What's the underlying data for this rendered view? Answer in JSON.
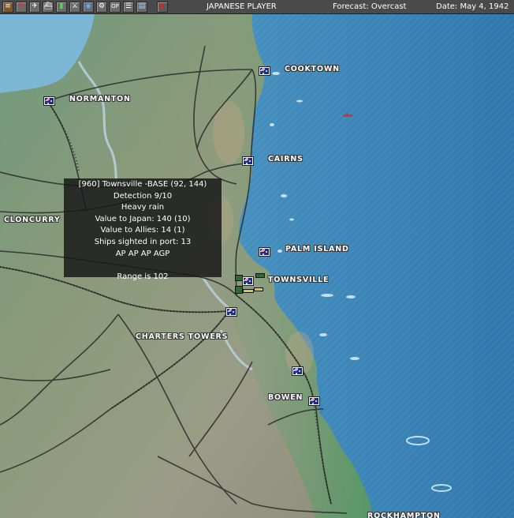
{
  "toolbar": {
    "buttons": [
      "menu-icon",
      "flag-icon",
      "aircraft-icon",
      "ship-icon",
      "bar-chart-icon",
      "units-icon",
      "globe-icon",
      "settings-icon",
      "ops-icon",
      "list-icon",
      "report-icon",
      "end-turn-icon"
    ],
    "ops_label": "OP",
    "player": "JAPANESE PLAYER",
    "forecast": "Forecast: Overcast",
    "date": "Date: May 4, 1942"
  },
  "map": {
    "places": {
      "cooktown": "COOKTOWN",
      "normanton": "NORMANTON",
      "cairns": "CAIRNS",
      "cloncurry": "CLONCURRY",
      "palm_island": "PALM ISLAND",
      "townsville": "TOWNSVILLE",
      "charters_towers": "CHARTERS TOWERS",
      "bowen": "BOWEN",
      "rockhampton": "ROCKHAMPTON"
    }
  },
  "tooltip": {
    "line1": "[960] Townsville -BASE (92, 144)",
    "line2": "Detection 9/10",
    "line3": "Heavy rain",
    "line4": "Value to Japan: 140 (10)",
    "line5": "Value to Allies: 14 (1)",
    "line6": "Ships sighted in port: 13",
    "line7": "AP AP AP AGP",
    "line8": "",
    "line9": "Range is 102"
  },
  "colors": {
    "sea": "#3d86b8",
    "land": "#8a9a78",
    "coast_green": "#5fa06a",
    "road": "#2a2a2a",
    "river": "#a8c4d8"
  }
}
